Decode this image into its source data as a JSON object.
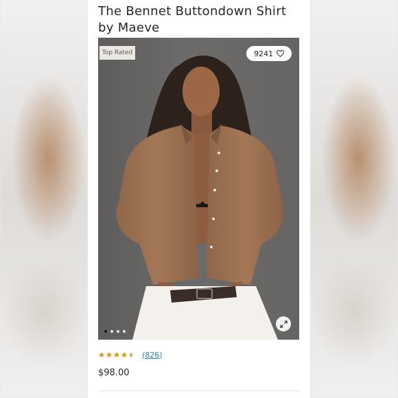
{
  "product": {
    "title": "The Bennet Buttondown Shirt by Maeve",
    "badge": "Top Rated",
    "likes": "9241",
    "rating_value": 4.5,
    "reviews": "(826)",
    "price": "$98.00"
  },
  "gallery": {
    "image_count": 4,
    "active_index": 0
  },
  "colors": {
    "star": "#c9a227",
    "link": "#2a7bb0",
    "shirt": "#9a6e52",
    "background": "#626060"
  },
  "icons": {
    "heart": "heart-icon",
    "expand": "expand-icon",
    "star": "star-icon"
  }
}
